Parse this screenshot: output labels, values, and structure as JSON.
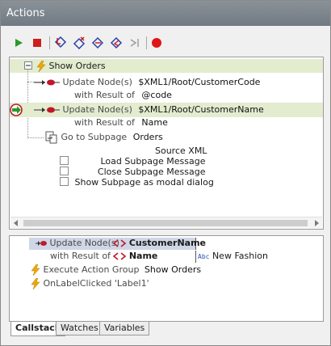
{
  "window": {
    "title": "Actions"
  },
  "toolbar": {
    "buttons": [
      {
        "name": "run",
        "icon": "play-icon",
        "color": "#2a9a2a"
      },
      {
        "name": "stop",
        "icon": "stop-icon",
        "color": "#cc1f1f"
      },
      {
        "name": "step-into",
        "icon": "step-into-icon"
      },
      {
        "name": "step-over",
        "icon": "step-over-icon"
      },
      {
        "name": "step-out",
        "icon": "step-out-icon"
      },
      {
        "name": "step-back",
        "icon": "step-back-icon"
      },
      {
        "name": "run-to-cursor",
        "icon": "run-to-cursor-icon"
      },
      {
        "name": "breakpoint",
        "icon": "breakpoint-icon",
        "color": "#e01515"
      }
    ]
  },
  "tree": {
    "group_label": "Show Orders",
    "expander": "−",
    "actions": [
      {
        "label": "Update Node(s)",
        "value": "$XML1/Root/CustomerCode",
        "result_label": "with Result of",
        "result_value": "@code"
      },
      {
        "label": "Update Node(s)",
        "value": "$XML1/Root/CustomerName",
        "result_label": "with Result of",
        "result_value": "Name"
      }
    ],
    "subpage": {
      "label": "Go to Subpage",
      "value": "Orders",
      "source": "Source XML",
      "options": [
        {
          "label": "Load Subpage Message",
          "checked": false
        },
        {
          "label": "Close Subpage Message",
          "checked": false
        },
        {
          "label": "Show Subpage as modal dialog",
          "checked": false
        }
      ]
    }
  },
  "callstack": {
    "update_label": "Update Node(s)",
    "update_value": "CustomerName",
    "result_label": "with Result of",
    "result_value": "Name",
    "result_type": "Abc",
    "result_string": "New Fashion",
    "frames": [
      {
        "label": "Execute Action Group",
        "value": "Show Orders"
      },
      {
        "label": "OnLabelClicked 'Label1'",
        "value": ""
      }
    ]
  },
  "tabs": [
    {
      "label": "Callstack",
      "active": true
    },
    {
      "label": "Watches",
      "active": false
    },
    {
      "label": "Variables",
      "active": false
    }
  ],
  "colors": {
    "highlight_row": "#e3eccf",
    "bolt": "#f0a800",
    "breakpoint": "#c0182a",
    "current_arrow": "#2a9a2a"
  }
}
